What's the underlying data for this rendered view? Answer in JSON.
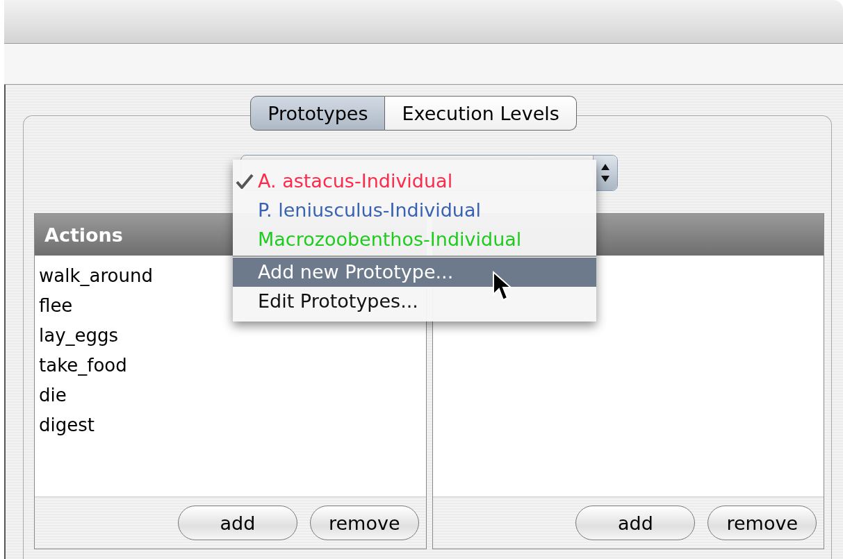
{
  "tabs": [
    {
      "label": "Prototypes",
      "selected": true
    },
    {
      "label": "Execution Levels",
      "selected": false
    }
  ],
  "prototype_menu": {
    "items": [
      {
        "kind": "prototype",
        "label": "A. astacus-Individual",
        "checked": true,
        "highlighted": false,
        "color": "#ff2a4a"
      },
      {
        "kind": "prototype",
        "label": "P. leniusculus-Individual",
        "checked": false,
        "highlighted": false,
        "color": "#3a62b4"
      },
      {
        "kind": "prototype",
        "label": "Macrozoobenthos-Individual",
        "checked": false,
        "highlighted": false,
        "color": "#1ecc1e"
      },
      {
        "kind": "command",
        "label": "Add new Prototype...",
        "checked": false,
        "highlighted": true
      },
      {
        "kind": "command",
        "label": "Edit Prototypes...",
        "checked": false,
        "highlighted": false
      }
    ]
  },
  "actions_panel": {
    "header": "Actions",
    "items": [
      "walk_around",
      "flee",
      "lay_eggs",
      "take_food",
      "die",
      "digest"
    ],
    "buttons": [
      "add",
      "remove"
    ]
  },
  "right_panel": {
    "buttons": [
      "add",
      "remove"
    ]
  }
}
